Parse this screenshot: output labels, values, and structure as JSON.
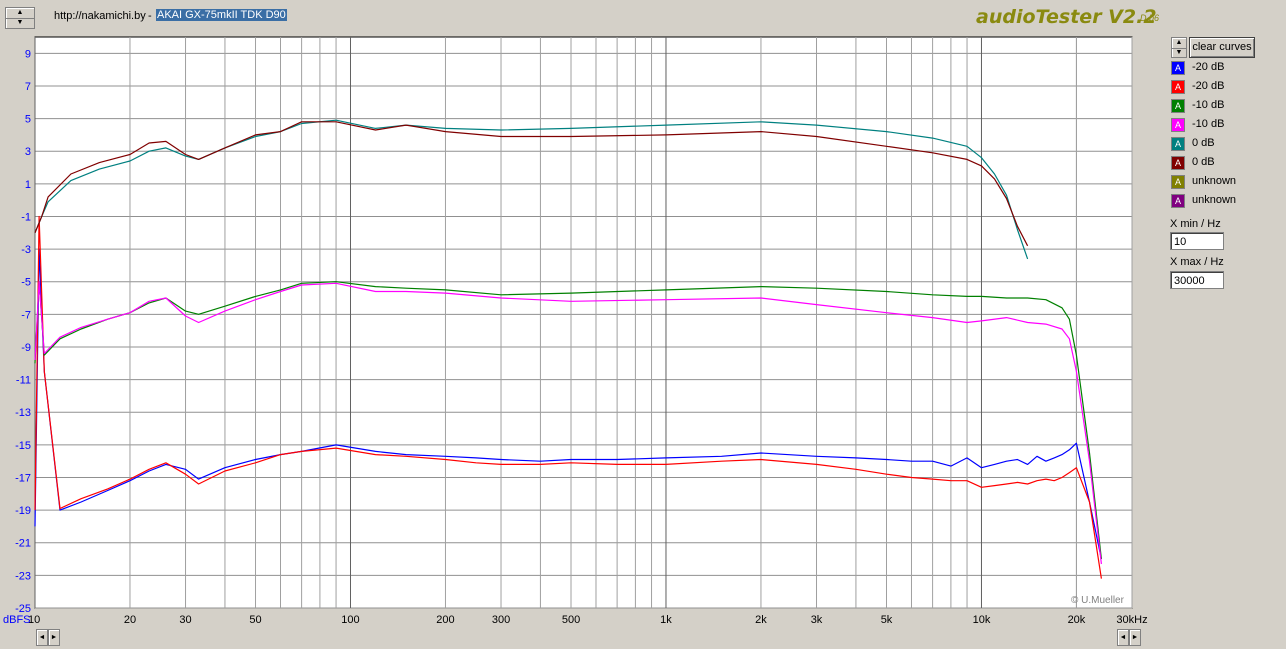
{
  "header": {
    "url": "http://nakamichi.by",
    "separator": "-",
    "title": "AKAI GX-75mkII TDK D90",
    "app_name": "audioTester V2.2",
    "app_build": "D b6"
  },
  "legend": {
    "clear_label": "clear curves",
    "items": [
      {
        "label": "-20 dB",
        "color": "#0000ff"
      },
      {
        "label": "-20 dB",
        "color": "#ff0000"
      },
      {
        "label": "-10 dB",
        "color": "#008000"
      },
      {
        "label": "-10 dB",
        "color": "#ff00ff"
      },
      {
        "label": "0 dB",
        "color": "#008080"
      },
      {
        "label": "0 dB",
        "color": "#800000"
      },
      {
        "label": "unknown",
        "color": "#808000"
      },
      {
        "label": "unknown",
        "color": "#800080"
      }
    ],
    "box_glyph": "A"
  },
  "controls": {
    "xmin_label": "X min / Hz",
    "xmin_value": "10",
    "xmax_label": "X max / Hz",
    "xmax_value": "30000"
  },
  "credit": "© U.Mueller",
  "chart_data": {
    "type": "line",
    "x_scale": "log",
    "xlim": [
      10,
      30000
    ],
    "ylim": [
      -25,
      10
    ],
    "grid": true,
    "ylabel": "dBFS",
    "y_ticks": [
      9,
      7,
      5,
      3,
      1,
      -1,
      -3,
      -5,
      -7,
      -9,
      -11,
      -13,
      -15,
      -17,
      -19,
      -21,
      -23,
      -25
    ],
    "x_ticks": [
      {
        "v": 10,
        "t": "10"
      },
      {
        "v": 20,
        "t": "20"
      },
      {
        "v": 30,
        "t": "30"
      },
      {
        "v": 50,
        "t": "50"
      },
      {
        "v": 100,
        "t": "100"
      },
      {
        "v": 200,
        "t": "200"
      },
      {
        "v": 300,
        "t": "300"
      },
      {
        "v": 500,
        "t": "500"
      },
      {
        "v": 1000,
        "t": "1k"
      },
      {
        "v": 2000,
        "t": "2k"
      },
      {
        "v": 3000,
        "t": "3k"
      },
      {
        "v": 5000,
        "t": "5k"
      },
      {
        "v": 10000,
        "t": "10k"
      },
      {
        "v": 20000,
        "t": "20k"
      },
      {
        "v": 30000,
        "t": "30kHz"
      }
    ],
    "series": [
      {
        "name": "-20 dB",
        "color": "#0000ff",
        "x": [
          10,
          10.3,
          10.7,
          12,
          14,
          17,
          20,
          23,
          26,
          30,
          33,
          40,
          50,
          60,
          70,
          90,
          120,
          150,
          200,
          250,
          300,
          400,
          500,
          700,
          1000,
          1500,
          2000,
          3000,
          4000,
          5000,
          6000,
          7000,
          8000,
          9000,
          10000,
          11000,
          12000,
          13000,
          14000,
          15000,
          16000,
          17000,
          18000,
          19000,
          20000,
          22000,
          24000
        ],
        "y": [
          -20,
          -3,
          -10.5,
          -19,
          -18.5,
          -17.8,
          -17.2,
          -16.6,
          -16.2,
          -16.5,
          -17.1,
          -16.4,
          -15.9,
          -15.6,
          -15.4,
          -15.0,
          -15.4,
          -15.6,
          -15.7,
          -15.8,
          -15.9,
          -16.0,
          -15.9,
          -15.9,
          -15.8,
          -15.7,
          -15.5,
          -15.7,
          -15.8,
          -15.9,
          -16.0,
          -16.0,
          -16.3,
          -15.8,
          -16.4,
          -16.2,
          -16.0,
          -15.9,
          -16.2,
          -15.7,
          -16.0,
          -15.8,
          -15.6,
          -15.3,
          -14.9,
          -18.5,
          -22.0
        ]
      },
      {
        "name": "-20 dB",
        "color": "#ff0000",
        "x": [
          10,
          10.3,
          10.7,
          12,
          14,
          17,
          20,
          23,
          26,
          30,
          33,
          40,
          50,
          60,
          70,
          90,
          120,
          150,
          200,
          250,
          300,
          400,
          500,
          700,
          1000,
          1500,
          2000,
          3000,
          4000,
          5000,
          6000,
          7000,
          8000,
          9000,
          10000,
          11000,
          12000,
          13000,
          14000,
          15000,
          16000,
          17000,
          18000,
          19000,
          20000,
          22000,
          24000
        ],
        "y": [
          -19,
          -1,
          -10.5,
          -18.9,
          -18.3,
          -17.7,
          -17.1,
          -16.5,
          -16.1,
          -16.8,
          -17.4,
          -16.6,
          -16.1,
          -15.6,
          -15.4,
          -15.2,
          -15.6,
          -15.7,
          -15.9,
          -16.1,
          -16.2,
          -16.2,
          -16.1,
          -16.2,
          -16.2,
          -16.0,
          -15.9,
          -16.2,
          -16.5,
          -16.8,
          -17.0,
          -17.1,
          -17.2,
          -17.2,
          -17.6,
          -17.5,
          -17.4,
          -17.3,
          -17.4,
          -17.2,
          -17.1,
          -17.2,
          -17.0,
          -16.7,
          -16.4,
          -18.5,
          -23.2
        ]
      },
      {
        "name": "-10 dB",
        "color": "#008000",
        "x": [
          10,
          10.3,
          10.7,
          12,
          14,
          17,
          20,
          23,
          26,
          30,
          33,
          40,
          50,
          60,
          70,
          90,
          120,
          150,
          200,
          300,
          500,
          1000,
          2000,
          3000,
          5000,
          7000,
          9000,
          10000,
          12000,
          14000,
          16000,
          18000,
          19000,
          20000,
          22000,
          24000
        ],
        "y": [
          -10,
          -5,
          -9.5,
          -8.5,
          -7.9,
          -7.3,
          -6.9,
          -6.3,
          -6.0,
          -6.8,
          -7.0,
          -6.5,
          -5.9,
          -5.5,
          -5.1,
          -5.0,
          -5.3,
          -5.4,
          -5.5,
          -5.8,
          -5.7,
          -5.5,
          -5.3,
          -5.4,
          -5.6,
          -5.8,
          -5.9,
          -5.9,
          -6.0,
          -6.0,
          -6.1,
          -6.6,
          -7.3,
          -9.5,
          -15.5,
          -22.0
        ]
      },
      {
        "name": "-10 dB",
        "color": "#ff00ff",
        "x": [
          10,
          10.3,
          10.7,
          12,
          14,
          17,
          20,
          23,
          26,
          30,
          33,
          40,
          50,
          60,
          70,
          90,
          120,
          150,
          200,
          300,
          500,
          1000,
          2000,
          3000,
          5000,
          7000,
          9000,
          10000,
          12000,
          14000,
          16000,
          18000,
          19000,
          20000,
          22000,
          24000
        ],
        "y": [
          -9.8,
          -5,
          -9.4,
          -8.4,
          -7.8,
          -7.3,
          -6.9,
          -6.2,
          -6.0,
          -7.1,
          -7.5,
          -6.8,
          -6.1,
          -5.6,
          -5.2,
          -5.1,
          -5.6,
          -5.6,
          -5.7,
          -6.0,
          -6.2,
          -6.1,
          -6.0,
          -6.4,
          -6.9,
          -7.2,
          -7.5,
          -7.4,
          -7.2,
          -7.5,
          -7.6,
          -7.9,
          -8.5,
          -10.5,
          -16.0,
          -22.3
        ]
      },
      {
        "name": "0 dB",
        "color": "#008080",
        "x": [
          10,
          10.5,
          11,
          13,
          16,
          20,
          23,
          26,
          30,
          33,
          40,
          50,
          60,
          70,
          90,
          120,
          150,
          200,
          300,
          500,
          1000,
          2000,
          3000,
          5000,
          7000,
          9000,
          10000,
          11000,
          12000,
          13000,
          14000
        ],
        "y": [
          -2,
          -1,
          -0.1,
          1.2,
          1.9,
          2.4,
          3.0,
          3.2,
          2.7,
          2.5,
          3.2,
          3.9,
          4.2,
          4.7,
          4.9,
          4.4,
          4.6,
          4.4,
          4.3,
          4.4,
          4.6,
          4.8,
          4.6,
          4.2,
          3.8,
          3.3,
          2.6,
          1.6,
          0.3,
          -1.8,
          -3.6
        ]
      },
      {
        "name": "0 dB",
        "color": "#800000",
        "x": [
          10,
          10.5,
          11,
          13,
          16,
          20,
          23,
          26,
          30,
          33,
          40,
          50,
          60,
          70,
          90,
          120,
          150,
          200,
          300,
          500,
          1000,
          2000,
          3000,
          5000,
          7000,
          9000,
          10000,
          11000,
          12000,
          13000,
          14000
        ],
        "y": [
          -2,
          -1,
          0.2,
          1.6,
          2.3,
          2.8,
          3.5,
          3.6,
          2.8,
          2.5,
          3.2,
          4.0,
          4.2,
          4.8,
          4.8,
          4.3,
          4.6,
          4.2,
          3.9,
          3.9,
          4.0,
          4.2,
          3.9,
          3.3,
          2.9,
          2.5,
          2.1,
          1.3,
          0.1,
          -1.6,
          -2.8
        ]
      }
    ]
  }
}
